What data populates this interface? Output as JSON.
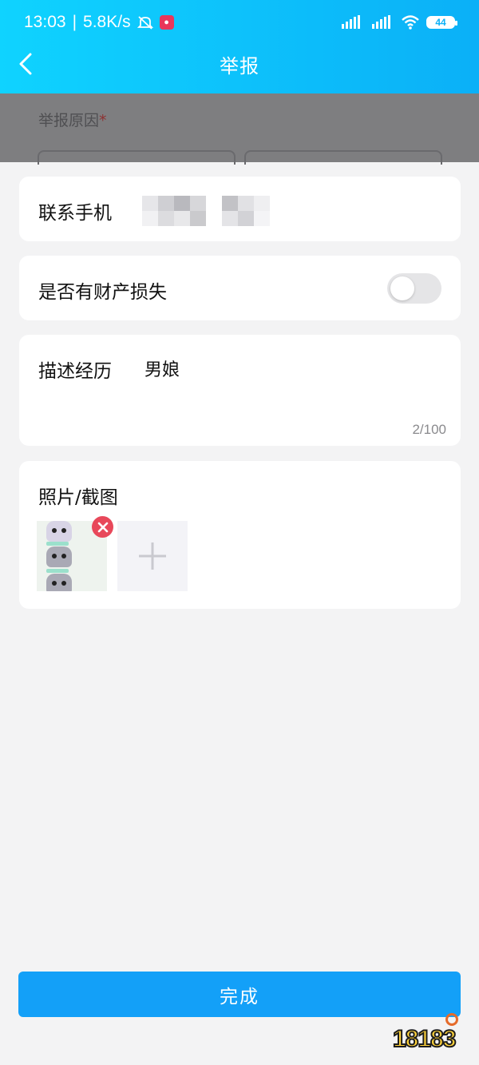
{
  "status_bar": {
    "time": "13:03",
    "net_speed": "5.8K/s",
    "battery": "44",
    "icons": [
      "mute-bell-icon",
      "app-icon",
      "hd-signal-icon",
      "wifi-icon",
      "battery-icon"
    ]
  },
  "nav": {
    "title": "举报",
    "back_icon": "back-arrow-icon"
  },
  "background_form": {
    "reason_label": "举报原因",
    "required_mark": "*"
  },
  "contact": {
    "label": "联系手机",
    "value_masked": true
  },
  "property_loss": {
    "label": "是否有财产损失",
    "toggle_on": false
  },
  "description": {
    "label": "描述经历",
    "value": "男娘",
    "counter": "2/100"
  },
  "photos": {
    "label": "照片/截图",
    "count": 1,
    "add_icon": "plus-icon",
    "remove_icon": "close-icon"
  },
  "actions": {
    "done_label": "完成"
  },
  "watermark": {
    "text": "18183"
  },
  "colors": {
    "header_start": "#0fd3ff",
    "header_end": "#0bb0f7",
    "primary_button": "#13a0f8",
    "remove_badge": "#e8485a",
    "background": "#f3f3f4"
  }
}
